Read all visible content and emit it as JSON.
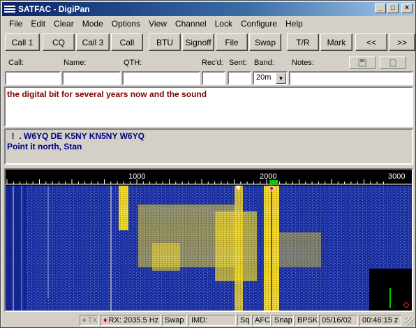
{
  "titlebar": {
    "title": "SATFAC - DigiPan",
    "buttons": [
      "_",
      "□",
      "×"
    ]
  },
  "menu": [
    "File",
    "Edit",
    "Clear",
    "Mode",
    "Options",
    "View",
    "Channel",
    "Lock",
    "Configure",
    "Help"
  ],
  "toolbar": [
    "Call 1",
    "CQ",
    "Call 3",
    "Call",
    "BTU",
    "Signoff",
    "File",
    "Swap",
    "T/R",
    "Mark",
    "<<",
    ">>"
  ],
  "fields": {
    "call_label": "Call:",
    "name_label": "Name:",
    "qth_label": "QTH:",
    "recd_label": "Rec'd:",
    "sent_label": "Sent:",
    "band_label": "Band:",
    "notes_label": "Notes:",
    "call_value": "",
    "name_value": "",
    "qth_value": "",
    "recd_value": "",
    "sent_value": "",
    "band_value": "20m",
    "notes_value": ""
  },
  "tx_text": "the digital bit for several years now and the sound",
  "rx_lines": [
    "  !  . W6YQ DE K5NY KN5NY W6YQ",
    "Point it north, Stan"
  ],
  "scale": {
    "ticks": [
      "1000",
      "2000",
      "3000"
    ]
  },
  "colors": {
    "waterfall_bg": "#1a2fa0",
    "signal": "#e8d020",
    "title_start": "#0a246a"
  },
  "status": {
    "tx": "TX",
    "rx": "RX: 2035.5 Hz",
    "swap": "Swap",
    "imd": "IMD:",
    "sq": "Sq",
    "afc": "AFC",
    "snap": "Snap",
    "mode": "BPSK",
    "date": "05/16/02",
    "time": "00:46:15 z"
  }
}
